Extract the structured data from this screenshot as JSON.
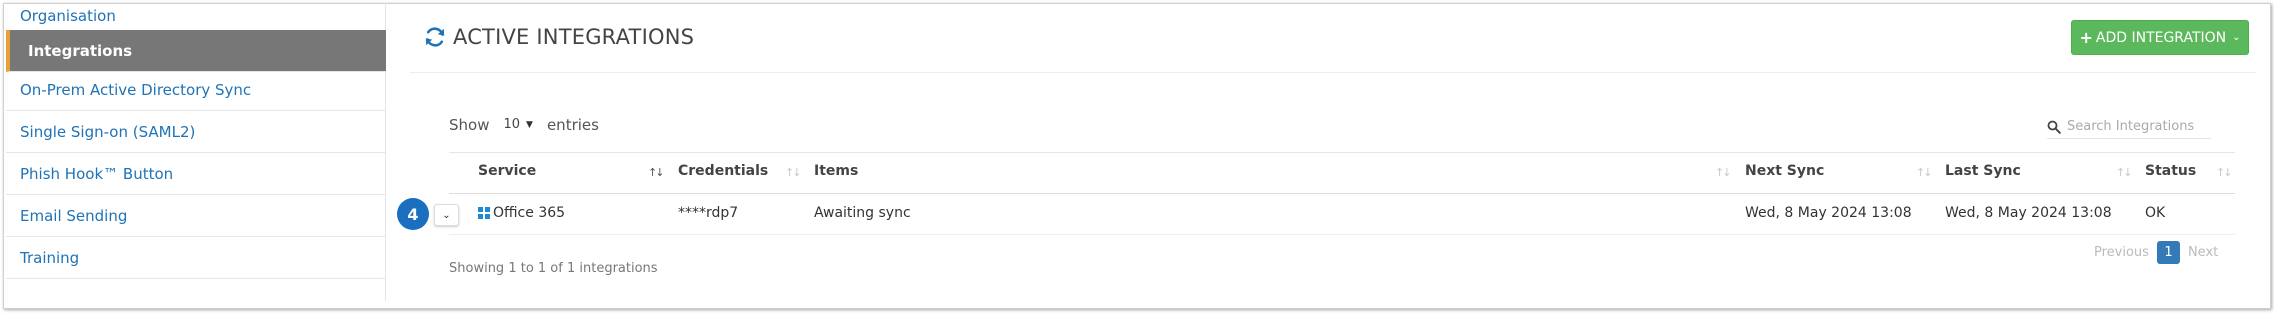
{
  "sidebar": {
    "items": [
      {
        "label": "Organisation",
        "active": false
      },
      {
        "label": "Integrations",
        "active": true
      },
      {
        "label": "On-Prem Active Directory Sync",
        "active": false
      },
      {
        "label": "Single Sign-on (SAML2)",
        "active": false
      },
      {
        "label": "Phish Hook™ Button",
        "active": false
      },
      {
        "label": "Email Sending",
        "active": false
      },
      {
        "label": "Training",
        "active": false
      }
    ]
  },
  "header": {
    "title": "ACTIVE INTEGRATIONS",
    "title_icon": "sync-icon",
    "add_button_label": "ADD INTEGRATION"
  },
  "controls": {
    "show_label": "Show",
    "entries_value": "10",
    "entries_label": "entries",
    "search_placeholder": "Search Integrations"
  },
  "table": {
    "columns": [
      "Service",
      "Credentials",
      "Items",
      "Next Sync",
      "Last Sync",
      "Status"
    ],
    "sorted_column": "Service",
    "rows": [
      {
        "badge": "4",
        "service": "Office 365",
        "credentials": "****rdp7",
        "items": "Awaiting sync",
        "next_sync": "Wed, 8 May 2024 13:08",
        "last_sync": "Wed, 8 May 2024 13:08",
        "status": "OK"
      }
    ],
    "info": "Showing 1 to 1 of 1 integrations"
  },
  "pagination": {
    "previous": "Previous",
    "current": "1",
    "next": "Next"
  },
  "colors": {
    "accent_green": "#5cb85c",
    "link_blue": "#1f73b7",
    "active_bg": "#777777",
    "active_border": "#e8a13a",
    "badge_blue": "#1a6fbf",
    "page_blue": "#337ab7"
  }
}
